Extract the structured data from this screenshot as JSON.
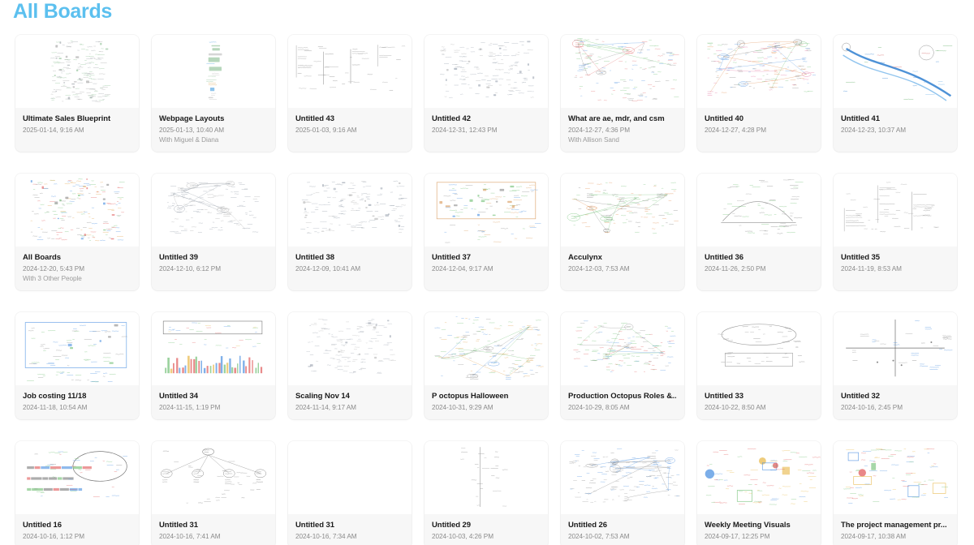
{
  "header": {
    "title": "All Boards",
    "title_color": "#5cc0ef"
  },
  "theme": {
    "background": "#ffffff",
    "card_background": "#f7f7f7",
    "thumb_background": "#ffffff",
    "title_text_color": "#1b1b1b",
    "meta_text_color": "#8b8b8b"
  },
  "grid": {
    "columns": 7,
    "rows": 4,
    "card_count": 28
  },
  "boards": [
    {
      "title": "Ultimate Sales Blueprint",
      "date": "2025-01-14, 9:16 AM",
      "shared": "",
      "thumb": {
        "style": "dense-notes",
        "seed": 11,
        "palette": [
          "#9aa0a6",
          "#8bbf93",
          "#a7a7a7"
        ],
        "density": 170,
        "region": [
          0.28,
          0.08,
          0.45,
          0.84
        ]
      }
    },
    {
      "title": "Webpage Layouts",
      "date": "2025-01-13, 10:40 AM",
      "shared": "With Miguel & Diana",
      "thumb": {
        "style": "column-blocks",
        "seed": 22,
        "palette": [
          "#4a9fe0",
          "#8bbf93",
          "#bdbdbd",
          "#e0a04a"
        ],
        "density": 55,
        "region": [
          0.45,
          0.1,
          0.16,
          0.8
        ]
      }
    },
    {
      "title": "Untitled 43",
      "date": "2025-01-03, 9:16 AM",
      "shared": "",
      "thumb": {
        "style": "table-grid",
        "seed": 33,
        "palette": [
          "#7a7a7a",
          "#9a9a9a"
        ],
        "density": 30,
        "region": [
          0.06,
          0.12,
          0.88,
          0.65
        ]
      }
    },
    {
      "title": "Untitled 42",
      "date": "2024-12-31, 12:43 PM",
      "shared": "",
      "thumb": {
        "style": "dense-notes",
        "seed": 44,
        "palette": [
          "#8e9aa8",
          "#a0a8b4",
          "#b0b0b0"
        ],
        "density": 140,
        "region": [
          0.12,
          0.08,
          0.76,
          0.78
        ]
      }
    },
    {
      "title": "What are ae, mdr, and csm",
      "date": "2024-12-27, 4:36 PM",
      "shared": "With Allison Sand",
      "thumb": {
        "style": "mindmap",
        "seed": 55,
        "palette": [
          "#e06a6a",
          "#6fbf73",
          "#4a8fe0",
          "#888888"
        ],
        "density": 120,
        "region": [
          0.1,
          0.06,
          0.82,
          0.86
        ]
      }
    },
    {
      "title": "Untitled 40",
      "date": "2024-12-27, 4:28 PM",
      "shared": "",
      "thumb": {
        "style": "mindmap",
        "seed": 66,
        "palette": [
          "#e08a4a",
          "#6fbf73",
          "#4a8fe0",
          "#e06a9a",
          "#808080"
        ],
        "density": 130,
        "region": [
          0.06,
          0.08,
          0.88,
          0.72
        ]
      }
    },
    {
      "title": "Untitled 41",
      "date": "2024-12-23, 10:37 AM",
      "shared": "",
      "thumb": {
        "style": "river",
        "seed": 77,
        "palette": [
          "#2f7fd0",
          "#6bb0e8",
          "#5aa95e",
          "#d05a5a"
        ],
        "density": 22,
        "region": [
          0.05,
          0.1,
          0.9,
          0.8
        ]
      }
    },
    {
      "title": "All Boards",
      "date": "2024-12-20, 5:43 PM",
      "shared": "With 3 Other People",
      "thumb": {
        "style": "dense-notes",
        "seed": 88,
        "palette": [
          "#e05a5a",
          "#4a8fe0",
          "#6fbf73",
          "#e0a04a",
          "#8a8a8a"
        ],
        "density": 175,
        "region": [
          0.12,
          0.06,
          0.74,
          0.86
        ]
      }
    },
    {
      "title": "Untitled 39",
      "date": "2024-12-10, 6:12 PM",
      "shared": "",
      "thumb": {
        "style": "mindmap",
        "seed": 99,
        "palette": [
          "#9098a4",
          "#a8a8a8",
          "#8f9aa6"
        ],
        "density": 95,
        "region": [
          0.12,
          0.12,
          0.72,
          0.7
        ]
      }
    },
    {
      "title": "Untitled 38",
      "date": "2024-12-09, 10:41 AM",
      "shared": "",
      "thumb": {
        "style": "dense-notes",
        "seed": 101,
        "palette": [
          "#909aa6",
          "#a5adb8",
          "#b4b4b4"
        ],
        "density": 150,
        "region": [
          0.1,
          0.1,
          0.82,
          0.72
        ]
      }
    },
    {
      "title": "Untitled 37",
      "date": "2024-12-04, 9:17 AM",
      "shared": "",
      "thumb": {
        "style": "framed-diagram",
        "seed": 112,
        "palette": [
          "#d99a5a",
          "#4a8fe0",
          "#6fbf73",
          "#8a8a8a"
        ],
        "density": 70,
        "region": [
          0.1,
          0.12,
          0.8,
          0.5
        ]
      }
    },
    {
      "title": "Acculynx",
      "date": "2024-12-03, 7:53 AM",
      "shared": "",
      "thumb": {
        "style": "mindmap",
        "seed": 123,
        "palette": [
          "#e08a4a",
          "#7a7a7a",
          "#6fbf73"
        ],
        "density": 85,
        "region": [
          0.08,
          0.12,
          0.84,
          0.7
        ]
      }
    },
    {
      "title": "Untitled 36",
      "date": "2024-11-26, 2:50 PM",
      "shared": "",
      "thumb": {
        "style": "chart-sketch",
        "seed": 134,
        "palette": [
          "#6fbf73",
          "#7a7a7a",
          "#9a9a9a"
        ],
        "density": 60,
        "region": [
          0.18,
          0.08,
          0.62,
          0.76
        ]
      }
    },
    {
      "title": "Untitled 35",
      "date": "2024-11-19, 8:53 AM",
      "shared": "",
      "thumb": {
        "style": "table-grid",
        "seed": 145,
        "palette": [
          "#8a8a8a",
          "#a0a0a0"
        ],
        "density": 34,
        "region": [
          0.08,
          0.1,
          0.82,
          0.72
        ]
      }
    },
    {
      "title": "Job costing 11/18",
      "date": "2024-11-18, 10:54 AM",
      "shared": "",
      "thumb": {
        "style": "framed-diagram",
        "seed": 156,
        "palette": [
          "#4a8fe0",
          "#6fbf73",
          "#8a8a8a"
        ],
        "density": 55,
        "region": [
          0.08,
          0.14,
          0.82,
          0.62
        ]
      }
    },
    {
      "title": "Untitled 34",
      "date": "2024-11-15, 1:19 PM",
      "shared": "",
      "thumb": {
        "style": "bar-chart",
        "seed": 167,
        "palette": [
          "#e8b84a",
          "#6fbf73",
          "#4a8fe0",
          "#e05a5a"
        ],
        "density": 44,
        "region": [
          0.08,
          0.1,
          0.84,
          0.8
        ]
      }
    },
    {
      "title": "Scaling Nov 14",
      "date": "2024-11-14, 9:17 AM",
      "shared": "",
      "thumb": {
        "style": "dense-notes",
        "seed": 178,
        "palette": [
          "#9aa2ae",
          "#acb2bc",
          "#b8b8b8"
        ],
        "density": 130,
        "region": [
          0.14,
          0.08,
          0.7,
          0.76
        ]
      }
    },
    {
      "title": "P octopus Halloween",
      "date": "2024-10-31, 9:29 AM",
      "shared": "",
      "thumb": {
        "style": "mindmap",
        "seed": 189,
        "palette": [
          "#6fbf73",
          "#4a8fe0",
          "#8a8a8a",
          "#e0a04a"
        ],
        "density": 125,
        "region": [
          0.08,
          0.06,
          0.86,
          0.84
        ]
      }
    },
    {
      "title": "Production Octopus Roles &...",
      "date": "2024-10-29, 8:05 AM",
      "shared": "",
      "thumb": {
        "style": "mindmap",
        "seed": 191,
        "palette": [
          "#4a8fe0",
          "#e05a5a",
          "#8a8a8a",
          "#6fbf73"
        ],
        "density": 110,
        "region": [
          0.1,
          0.1,
          0.8,
          0.72
        ]
      }
    },
    {
      "title": "Untitled 33",
      "date": "2024-10-22, 8:50 AM",
      "shared": "",
      "thumb": {
        "style": "oval-flow",
        "seed": 202,
        "palette": [
          "#7a7a7a",
          "#9a9a9a"
        ],
        "density": 40,
        "region": [
          0.14,
          0.14,
          0.72,
          0.6
        ]
      }
    },
    {
      "title": "Untitled 32",
      "date": "2024-10-16, 2:45 PM",
      "shared": "",
      "thumb": {
        "style": "quadrant",
        "seed": 213,
        "palette": [
          "#7a7a7a",
          "#4a8fe0",
          "#9a9a9a"
        ],
        "density": 26,
        "region": [
          0.1,
          0.1,
          0.8,
          0.78
        ]
      }
    },
    {
      "title": "Untitled 16",
      "date": "2024-10-16, 1:12 PM",
      "shared": "",
      "thumb": {
        "style": "timeline-bars",
        "seed": 224,
        "palette": [
          "#6fbf73",
          "#4a8fe0",
          "#e05a5a",
          "#7a7a7a"
        ],
        "density": 38,
        "region": [
          0.08,
          0.14,
          0.84,
          0.68
        ]
      }
    },
    {
      "title": "Untitled 31",
      "date": "2024-10-16, 7:41 AM",
      "shared": "",
      "thumb": {
        "style": "org-tree",
        "seed": 235,
        "palette": [
          "#6a6a6a",
          "#8a8a8a"
        ],
        "density": 30,
        "region": [
          0.08,
          0.1,
          0.84,
          0.76
        ]
      }
    },
    {
      "title": "Untitled 31",
      "date": "2024-10-16, 7:34 AM",
      "shared": "",
      "thumb": {
        "style": "blank",
        "seed": 246,
        "palette": [
          "#b0b0b0"
        ],
        "density": 0,
        "region": [
          0.3,
          0.3,
          0.4,
          0.4
        ]
      }
    },
    {
      "title": "Untitled 29",
      "date": "2024-10-03, 4:26 PM",
      "shared": "",
      "thumb": {
        "style": "axis-sketch",
        "seed": 257,
        "palette": [
          "#8a8a8a",
          "#a0a0a0"
        ],
        "density": 22,
        "region": [
          0.28,
          0.08,
          0.38,
          0.82
        ]
      }
    },
    {
      "title": "Untitled 26",
      "date": "2024-10-02, 7:53 AM",
      "shared": "",
      "thumb": {
        "style": "mindmap",
        "seed": 268,
        "palette": [
          "#7a7a7a",
          "#4a8fe0",
          "#9a9a9a"
        ],
        "density": 115,
        "region": [
          0.06,
          0.1,
          0.88,
          0.74
        ]
      }
    },
    {
      "title": "Weekly Meeting Visuals",
      "date": "2024-09-17, 12:25 PM",
      "shared": "",
      "thumb": {
        "style": "colorful-sticky",
        "seed": 279,
        "palette": [
          "#e8b84a",
          "#6fbf73",
          "#4a8fe0",
          "#e05a5a"
        ],
        "density": 70,
        "region": [
          0.06,
          0.1,
          0.88,
          0.78
        ]
      }
    },
    {
      "title": "The project management pr...",
      "date": "2024-09-17, 10:38 AM",
      "shared": "",
      "thumb": {
        "style": "colorful-sticky",
        "seed": 281,
        "palette": [
          "#e05a5a",
          "#4a8fe0",
          "#e8b84a",
          "#6fbf73"
        ],
        "density": 72,
        "region": [
          0.08,
          0.1,
          0.84,
          0.76
        ]
      }
    }
  ]
}
